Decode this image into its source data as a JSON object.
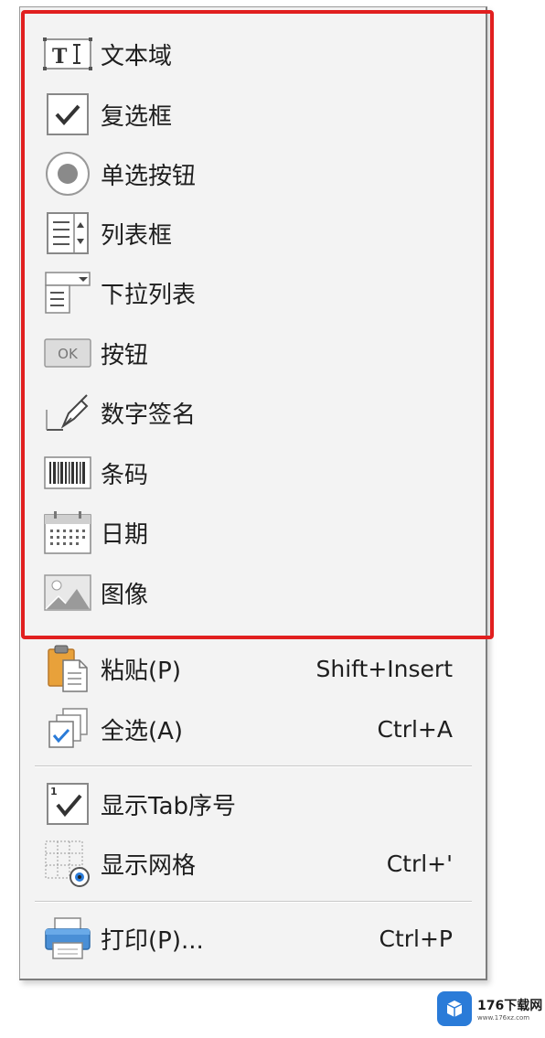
{
  "menu": {
    "form_fields": [
      {
        "label": "文本域",
        "icon": "text-field-icon"
      },
      {
        "label": "复选框",
        "icon": "checkbox-icon"
      },
      {
        "label": "单选按钮",
        "icon": "radio-button-icon"
      },
      {
        "label": "列表框",
        "icon": "list-box-icon"
      },
      {
        "label": "下拉列表",
        "icon": "dropdown-list-icon"
      },
      {
        "label": "按钮",
        "icon": "button-icon",
        "icon_text": "OK"
      },
      {
        "label": "数字签名",
        "icon": "signature-icon"
      },
      {
        "label": "条码",
        "icon": "barcode-icon"
      },
      {
        "label": "日期",
        "icon": "date-icon"
      },
      {
        "label": "图像",
        "icon": "image-icon"
      }
    ],
    "edit": [
      {
        "label": "粘贴(P)",
        "shortcut": "Shift+Insert",
        "icon": "paste-icon"
      },
      {
        "label": "全选(A)",
        "shortcut": "Ctrl+A",
        "icon": "select-all-icon"
      }
    ],
    "view": [
      {
        "label": "显示Tab序号",
        "shortcut": "",
        "icon": "tab-order-icon"
      },
      {
        "label": "显示网格",
        "shortcut": "Ctrl+'",
        "icon": "grid-icon"
      }
    ],
    "print": {
      "label": "打印(P)...",
      "shortcut": "Ctrl+P",
      "icon": "printer-icon"
    }
  },
  "watermark": {
    "title": "176下载网",
    "subtitle": "www.176xz.com"
  },
  "colors": {
    "highlight": "#e11f1f",
    "menu_bg": "#f3f3f3",
    "accent": "#2a7bd8"
  }
}
